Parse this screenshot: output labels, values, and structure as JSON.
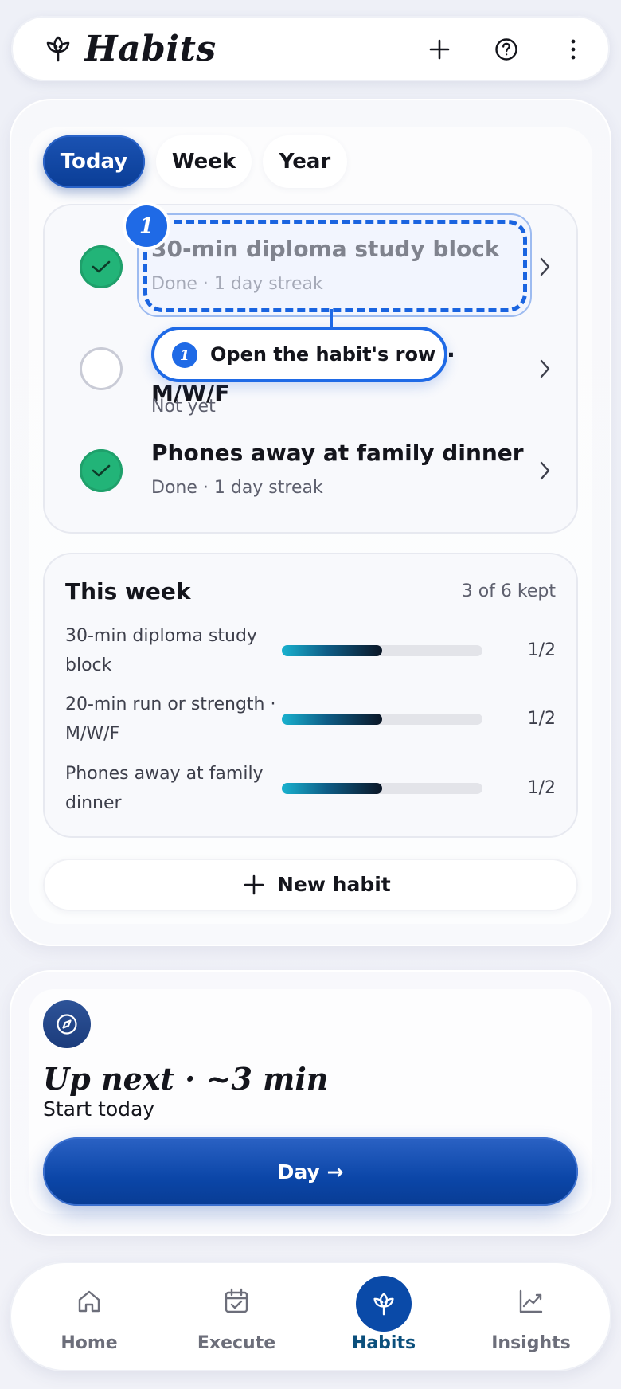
{
  "header": {
    "title": "Habits",
    "icons": [
      "lotus-icon",
      "plus-icon",
      "help-icon",
      "more-vertical-icon"
    ]
  },
  "tabs": [
    {
      "label": "Today",
      "active": true
    },
    {
      "label": "Week",
      "active": false
    },
    {
      "label": "Year",
      "active": false
    }
  ],
  "habits": [
    {
      "title": "30-min diploma study block",
      "status": "Done · 1 day streak",
      "done": true
    },
    {
      "title": "20-min run or strength · M/W/F",
      "status": "Not yet",
      "done": false
    },
    {
      "title": "Phones away at family dinner",
      "status": "Done · 1 day streak",
      "done": true
    }
  ],
  "tutorial": {
    "step": "1",
    "callout": "Open the habit's row"
  },
  "week": {
    "title": "This week",
    "kept": "3 of 6 kept",
    "rows": [
      {
        "label": "30-min diploma study block",
        "count": "1/2",
        "progress": 0.5
      },
      {
        "label": "20-min run or strength · M/W/F",
        "count": "1/2",
        "progress": 0.5
      },
      {
        "label": "Phones away at family dinner",
        "count": "1/2",
        "progress": 0.5
      }
    ]
  },
  "new_habit": {
    "label": "New habit"
  },
  "up_next": {
    "title": "Up next · ~3 min",
    "subtitle": "Start today",
    "button": "Day →"
  },
  "nav": [
    {
      "label": "Home",
      "icon": "home-icon",
      "active": false
    },
    {
      "label": "Execute",
      "icon": "calendar-check-icon",
      "active": false
    },
    {
      "label": "Habits",
      "icon": "lotus-icon",
      "active": true
    },
    {
      "label": "Insights",
      "icon": "trend-chart-icon",
      "active": false
    }
  ],
  "colors": {
    "accent": "#0a4aa8",
    "done": "#22b478",
    "tutorial": "#1f6ae6"
  }
}
